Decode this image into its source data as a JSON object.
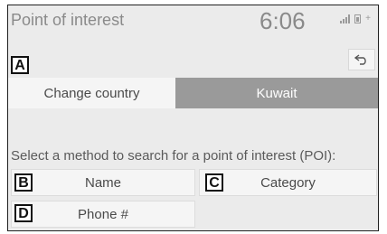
{
  "header": {
    "title": "Point of interest",
    "clock": "6:06",
    "status_icons": [
      "signal-icon",
      "battery-icon",
      "bluetooth-icon"
    ]
  },
  "markers": {
    "a": "A",
    "b": "B",
    "c": "C",
    "d": "D"
  },
  "country_row": {
    "change_label": "Change country",
    "current_country": "Kuwait"
  },
  "instruction": "Select a method to search for a point of interest (POI):",
  "options": {
    "name": "Name",
    "category": "Category",
    "phone": "Phone #"
  },
  "colors": {
    "selected_fill": "#9a9a9a",
    "button_fill": "#f5f5f5",
    "screen_bg": "#ebebeb"
  }
}
